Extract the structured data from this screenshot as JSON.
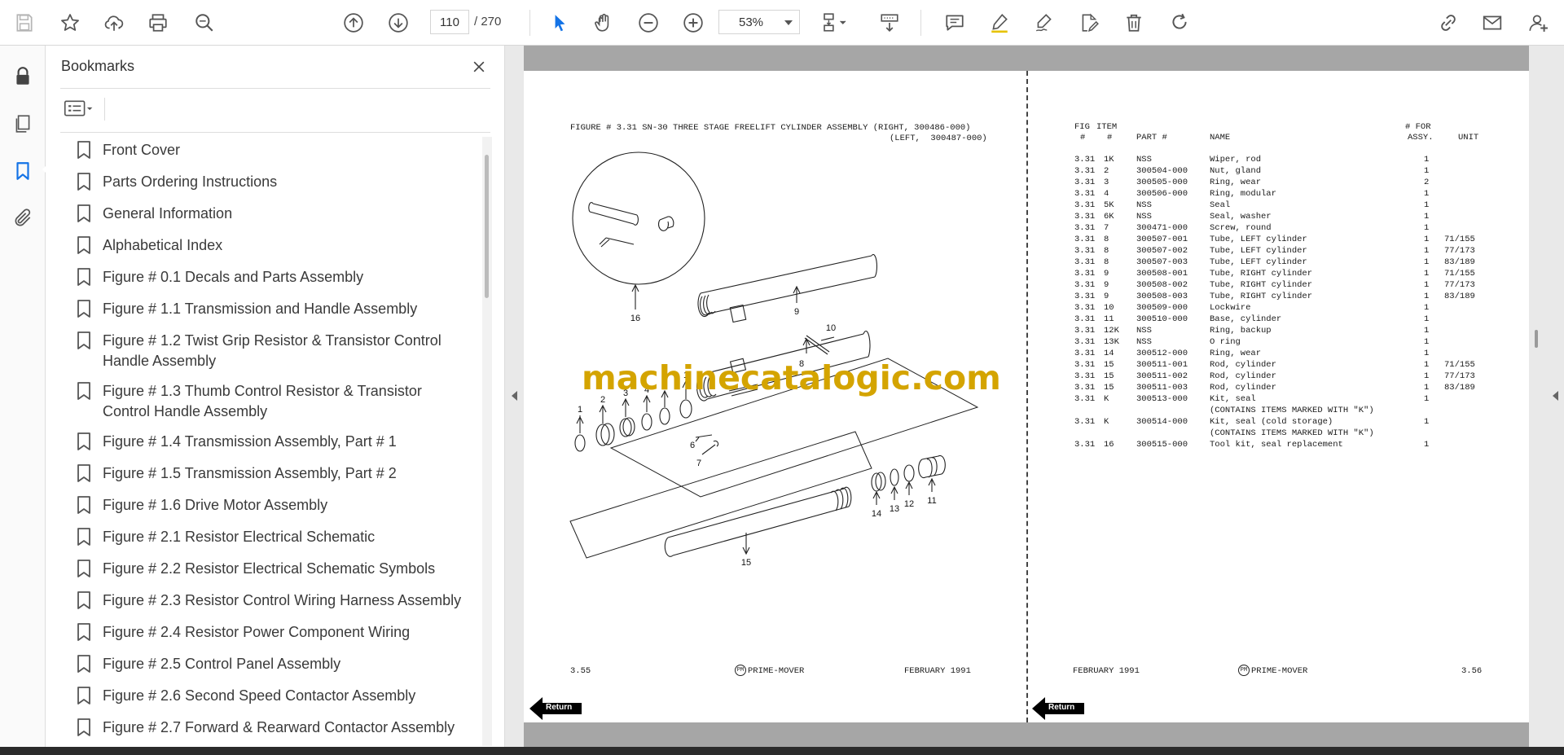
{
  "toolbar": {
    "page_current": "110",
    "page_total": "/ 270",
    "zoom": "53%"
  },
  "bookmarks": {
    "title": "Bookmarks",
    "items": [
      {
        "label": "Front Cover"
      },
      {
        "label": "Parts Ordering Instructions"
      },
      {
        "label": "General Information"
      },
      {
        "label": "Alphabetical Index"
      },
      {
        "label": "Figure # 0.1 Decals and Parts Assembly"
      },
      {
        "label": "Figure # 1.1 Transmission and Handle Assembly"
      },
      {
        "label": "Figure # 1.2 Twist Grip Resistor & Transistor Control Handle Assembly"
      },
      {
        "label": "Figure # 1.3 Thumb Control Resistor & Transistor Control Handle Assembly"
      },
      {
        "label": "Figure # 1.4 Transmission Assembly, Part # 1"
      },
      {
        "label": "Figure # 1.5 Transmission Assembly, Part # 2"
      },
      {
        "label": "Figure # 1.6 Drive Motor Assembly"
      },
      {
        "label": "Figure # 2.1 Resistor Electrical Schematic"
      },
      {
        "label": "Figure # 2.2 Resistor Electrical Schematic Symbols"
      },
      {
        "label": "Figure # 2.3 Resistor Control Wiring Harness Assembly"
      },
      {
        "label": "Figure # 2.4 Resistor Power Component Wiring"
      },
      {
        "label": "Figure # 2.5 Control Panel Assembly"
      },
      {
        "label": "Figure # 2.6 Second Speed Contactor Assembly"
      },
      {
        "label": "Figure # 2.7 Forward & Rearward Contactor Assembly"
      }
    ]
  },
  "document": {
    "figure_title_line1": "FIGURE # 3.31 SN-30 THREE STAGE FREELIFT CYLINDER ASSEMBLY (RIGHT, 300486-000)",
    "figure_title_line2": "(LEFT,  300487-000)",
    "watermark": "machinecatalogic.com",
    "diagram_labels": [
      "16",
      "9",
      "10",
      "8",
      "1",
      "2",
      "3",
      "4",
      "5",
      "1",
      "6",
      "7",
      "15",
      "14",
      "13",
      "12",
      "11"
    ],
    "table_headers": {
      "fig": "FIG",
      "item": "ITEM",
      "fig_no": "#",
      "item_no": "#",
      "part": "PART #",
      "name": "NAME",
      "for": "# FOR",
      "assy": "ASSY.",
      "unit": "UNIT"
    },
    "parts": [
      {
        "fig": "3.31",
        "item": "1K",
        "part": "NSS",
        "name": "Wiper, rod",
        "qty": "1",
        "unit": ""
      },
      {
        "fig": "3.31",
        "item": "2",
        "part": "300504-000",
        "name": "Nut, gland",
        "qty": "1",
        "unit": ""
      },
      {
        "fig": "3.31",
        "item": "3",
        "part": "300505-000",
        "name": "Ring, wear",
        "qty": "2",
        "unit": ""
      },
      {
        "fig": "3.31",
        "item": "4",
        "part": "300506-000",
        "name": "Ring, modular",
        "qty": "1",
        "unit": ""
      },
      {
        "fig": "3.31",
        "item": "5K",
        "part": "NSS",
        "name": "Seal",
        "qty": "1",
        "unit": ""
      },
      {
        "fig": "3.31",
        "item": "6K",
        "part": "NSS",
        "name": "Seal, washer",
        "qty": "1",
        "unit": ""
      },
      {
        "fig": "3.31",
        "item": "7",
        "part": "300471-000",
        "name": "Screw, round",
        "qty": "1",
        "unit": ""
      },
      {
        "fig": "3.31",
        "item": "8",
        "part": "300507-001",
        "name": "Tube, LEFT cylinder",
        "qty": "1",
        "unit": "71/155"
      },
      {
        "fig": "3.31",
        "item": "8",
        "part": "300507-002",
        "name": "Tube, LEFT cylinder",
        "qty": "1",
        "unit": "77/173"
      },
      {
        "fig": "3.31",
        "item": "8",
        "part": "300507-003",
        "name": "Tube, LEFT cylinder",
        "qty": "1",
        "unit": "83/189"
      },
      {
        "fig": "3.31",
        "item": "9",
        "part": "300508-001",
        "name": "Tube, RIGHT cylinder",
        "qty": "1",
        "unit": "71/155"
      },
      {
        "fig": "3.31",
        "item": "9",
        "part": "300508-002",
        "name": "Tube, RIGHT cylinder",
        "qty": "1",
        "unit": "77/173"
      },
      {
        "fig": "3.31",
        "item": "9",
        "part": "300508-003",
        "name": "Tube, RIGHT cylinder",
        "qty": "1",
        "unit": "83/189"
      },
      {
        "fig": "3.31",
        "item": "10",
        "part": "300509-000",
        "name": "Lockwire",
        "qty": "1",
        "unit": ""
      },
      {
        "fig": "3.31",
        "item": "11",
        "part": "300510-000",
        "name": "Base, cylinder",
        "qty": "1",
        "unit": ""
      },
      {
        "fig": "3.31",
        "item": "12K",
        "part": "NSS",
        "name": "Ring, backup",
        "qty": "1",
        "unit": ""
      },
      {
        "fig": "3.31",
        "item": "13K",
        "part": "NSS",
        "name": "O ring",
        "qty": "1",
        "unit": ""
      },
      {
        "fig": "3.31",
        "item": "14",
        "part": "300512-000",
        "name": "Ring, wear",
        "qty": "1",
        "unit": ""
      },
      {
        "fig": "3.31",
        "item": "15",
        "part": "300511-001",
        "name": "Rod, cylinder",
        "qty": "1",
        "unit": "71/155"
      },
      {
        "fig": "3.31",
        "item": "15",
        "part": "300511-002",
        "name": "Rod, cylinder",
        "qty": "1",
        "unit": "77/173"
      },
      {
        "fig": "3.31",
        "item": "15",
        "part": "300511-003",
        "name": "Rod, cylinder",
        "qty": "1",
        "unit": "83/189"
      },
      {
        "fig": "3.31",
        "item": "K",
        "part": "300513-000",
        "name": "Kit, seal",
        "qty": "1",
        "unit": ""
      },
      {
        "fig": "",
        "item": "",
        "part": "",
        "name": "(CONTAINS ITEMS MARKED WITH \"K\")",
        "qty": "",
        "unit": ""
      },
      {
        "fig": "3.31",
        "item": "K",
        "part": "300514-000",
        "name": "Kit, seal (cold storage)",
        "qty": "1",
        "unit": ""
      },
      {
        "fig": "",
        "item": "",
        "part": "",
        "name": "(CONTAINS ITEMS MARKED WITH \"K\")",
        "qty": "",
        "unit": ""
      },
      {
        "fig": "3.31",
        "item": "16",
        "part": "300515-000",
        "name": "Tool kit, seal replacement",
        "qty": "1",
        "unit": ""
      }
    ],
    "left_footer": {
      "page": "3.55",
      "brand": "PRIME-MOVER",
      "date": "FEBRUARY 1991"
    },
    "right_footer": {
      "date": "FEBRUARY 1991",
      "brand": "PRIME-MOVER",
      "page": "3.56"
    },
    "brand_logo": "PM",
    "return_label": "Return"
  },
  "icons": {
    "accent": "#1473e6"
  }
}
